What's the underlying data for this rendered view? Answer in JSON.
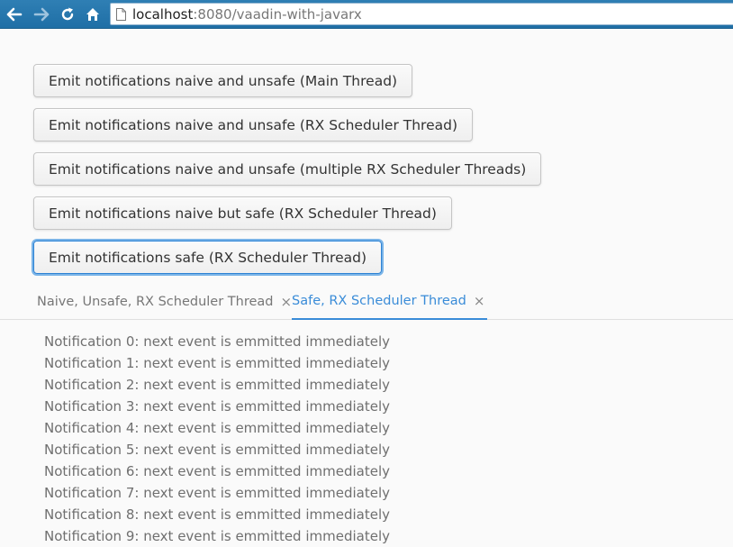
{
  "browser": {
    "url_host": "localhost",
    "url_path": ":8080/vaadin-with-javarx",
    "icons": [
      "back-arrow-icon",
      "forward-arrow-icon",
      "reload-icon",
      "home-icon",
      "page-icon"
    ]
  },
  "buttons": [
    {
      "label": "Emit notifications naive and unsafe (Main Thread)"
    },
    {
      "label": "Emit notifications naive and unsafe (RX Scheduler Thread)"
    },
    {
      "label": "Emit notifications naive and unsafe (multiple RX Scheduler Threads)"
    },
    {
      "label": "Emit notifications naive but safe (RX Scheduler Thread)"
    },
    {
      "label": "Emit notifications safe (RX Scheduler Thread)",
      "focused": true
    }
  ],
  "tabs": [
    {
      "label": "Naive, Unsafe, RX Scheduler Thread",
      "close": "×",
      "selected": false
    },
    {
      "label": "Safe, RX Scheduler Thread",
      "close": "×",
      "selected": true
    }
  ],
  "notifications": [
    "Notification 0: next event is emmitted immediately",
    "Notification 1: next event is emmitted immediately",
    "Notification 2: next event is emmitted immediately",
    "Notification 3: next event is emmitted immediately",
    "Notification 4: next event is emmitted immediately",
    "Notification 5: next event is emmitted immediately",
    "Notification 6: next event is emmitted immediately",
    "Notification 7: next event is emmitted immediately",
    "Notification 8: next event is emmitted immediately",
    "Notification 9: next event is emmitted immediately"
  ],
  "colors": {
    "browser_bar": "#2f7fb4",
    "selected_tab": "#3a8cd8",
    "focus_ring": "#2c82d4"
  }
}
